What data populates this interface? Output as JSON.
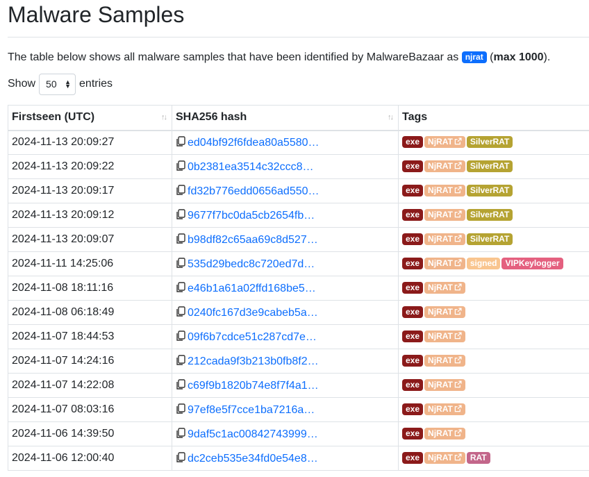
{
  "page": {
    "title": "Malware Samples",
    "intro_before": "The table below shows all malware samples that have been identified by MalwareBazaar as ",
    "intro_badge": "njrat",
    "intro_after_open": " (",
    "intro_bold": "max 1000",
    "intro_after_close": ")."
  },
  "length_control": {
    "show_label": "Show",
    "value": "50",
    "entries_label": "entries"
  },
  "colors": {
    "accent_blue": "#0d6efd",
    "tag_exe": "#8b1a1a",
    "tag_njrat": "#f0b48a",
    "tag_silverrat": "#b5a332",
    "tag_signed": "#f9c58f",
    "tag_vipkeylogger": "#e4607f",
    "tag_rat": "#c3668a"
  },
  "table": {
    "columns": [
      "Firstseen (UTC)",
      "SHA256 hash",
      "Tags"
    ],
    "rows": [
      {
        "date": "2024-11-13 20:09:27",
        "hash": "ed04bf92f6fdea80a5580…",
        "tags": [
          "exe",
          "NjRAT",
          "SilverRAT"
        ]
      },
      {
        "date": "2024-11-13 20:09:22",
        "hash": "0b2381ea3514c32ccc8…",
        "tags": [
          "exe",
          "NjRAT",
          "SilverRAT"
        ]
      },
      {
        "date": "2024-11-13 20:09:17",
        "hash": "fd32b776edd0656ad550…",
        "tags": [
          "exe",
          "NjRAT",
          "SilverRAT"
        ]
      },
      {
        "date": "2024-11-13 20:09:12",
        "hash": "9677f7bc0da5cb2654fb…",
        "tags": [
          "exe",
          "NjRAT",
          "SilverRAT"
        ]
      },
      {
        "date": "2024-11-13 20:09:07",
        "hash": "b98df82c65aa69c8d527…",
        "tags": [
          "exe",
          "NjRAT",
          "SilverRAT"
        ]
      },
      {
        "date": "2024-11-11 14:25:06",
        "hash": "535d29bedc8c720ed7d…",
        "tags": [
          "exe",
          "NjRAT",
          "signed",
          "VIPKeylogger"
        ]
      },
      {
        "date": "2024-11-08 18:11:16",
        "hash": "e46b1a61a02ffd168be5…",
        "tags": [
          "exe",
          "NjRAT"
        ]
      },
      {
        "date": "2024-11-08 06:18:49",
        "hash": "0240fc167d3e9cabeb5a…",
        "tags": [
          "exe",
          "NjRAT"
        ]
      },
      {
        "date": "2024-11-07 18:44:53",
        "hash": "09f6b7cdce51c287cd7e…",
        "tags": [
          "exe",
          "NjRAT"
        ]
      },
      {
        "date": "2024-11-07 14:24:16",
        "hash": "212cada9f3b213b0fb8f2…",
        "tags": [
          "exe",
          "NjRAT"
        ]
      },
      {
        "date": "2024-11-07 14:22:08",
        "hash": "c69f9b1820b74e8f7f4a1…",
        "tags": [
          "exe",
          "NjRAT"
        ]
      },
      {
        "date": "2024-11-07 08:03:16",
        "hash": "97ef8e5f7cce1ba7216a…",
        "tags": [
          "exe",
          "NjRAT"
        ]
      },
      {
        "date": "2024-11-06 14:39:50",
        "hash": "9daf5c1ac00842743999…",
        "tags": [
          "exe",
          "NjRAT"
        ]
      },
      {
        "date": "2024-11-06 12:00:40",
        "hash": "dc2ceb535e34fd0e54e8…",
        "tags": [
          "exe",
          "NjRAT",
          "RAT"
        ]
      }
    ]
  }
}
